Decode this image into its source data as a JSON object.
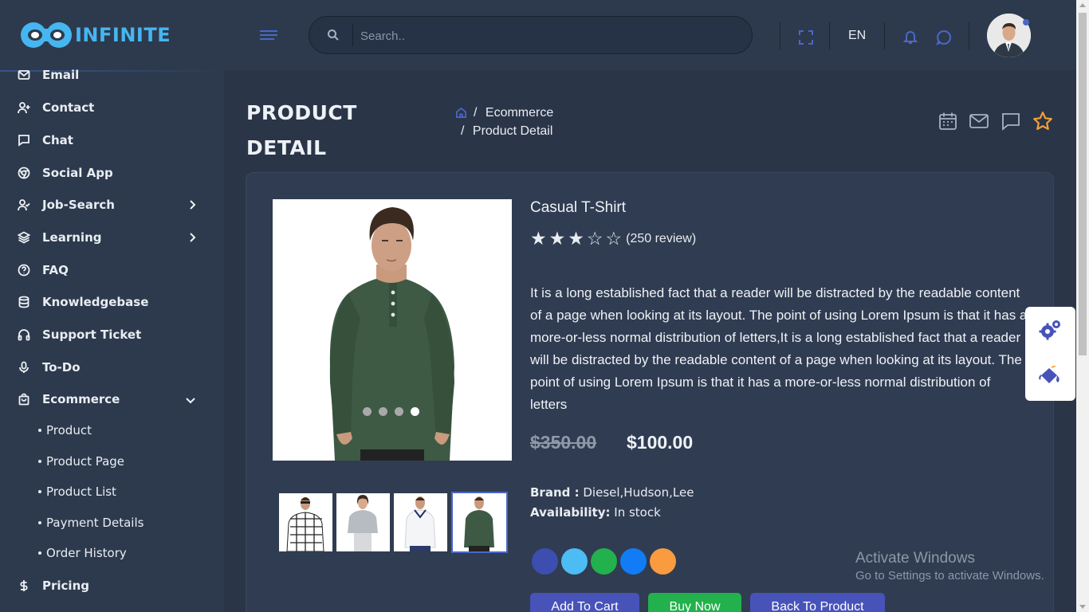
{
  "brand": {
    "name": "INFINITE",
    "accent": "#45b6f0"
  },
  "header": {
    "search_placeholder": "Search..",
    "language": "EN",
    "icons": [
      "menu-icon",
      "search-icon",
      "fullscreen-icon",
      "bell-icon",
      "chat-bubble-icon"
    ]
  },
  "sidebar": {
    "items": [
      {
        "label": "Email",
        "icon": "mail-icon"
      },
      {
        "label": "Contact",
        "icon": "user-plus-icon"
      },
      {
        "label": "Chat",
        "icon": "chat-icon"
      },
      {
        "label": "Social App",
        "icon": "chrome-icon"
      },
      {
        "label": "Job-Search",
        "icon": "user-check-icon"
      },
      {
        "label": "Learning",
        "icon": "layers-icon"
      },
      {
        "label": "FAQ",
        "icon": "help-circle-icon"
      },
      {
        "label": "Knowledgebase",
        "icon": "database-icon"
      },
      {
        "label": "Support Ticket",
        "icon": "headphones-icon"
      },
      {
        "label": "To-Do",
        "icon": "mic-icon"
      },
      {
        "label": "Ecommerce",
        "icon": "shopping-bag-icon"
      },
      {
        "label": "Pricing",
        "icon": "dollar-icon"
      }
    ],
    "ecommerce_sub": [
      "Product",
      "Product Page",
      "Product List",
      "Payment Details",
      "Order History"
    ]
  },
  "page": {
    "title_line1": "PRODUCT",
    "title_line2": "DETAIL",
    "breadcrumb": [
      "Ecommerce",
      "Product Detail"
    ],
    "breadcrumb_sep": "/"
  },
  "product": {
    "name": "Casual T-Shirt",
    "rating": 3,
    "rating_max": 5,
    "reviews": "(250 review)",
    "description": "It is a long established fact that a reader will be distracted by the readable content of a page when looking at its layout. The point of using Lorem Ipsum is that it has a more-or-less normal distribution of letters,It is a long established fact that a reader will be distracted by the readable content of a page when looking at its layout. The point of using Lorem Ipsum is that it has a more-or-less normal distribution of letters",
    "old_price": "$350.00 ",
    "price": "$100.00",
    "brand_label": "Brand :",
    "brand_value": "Diesel,Hudson,Lee",
    "availability_label": "Availability:",
    "availability_value": "In stock",
    "colors": [
      "#3d4eb0",
      "#4dbcf4",
      "#22b14c",
      "#117cf5",
      "#f99b3f"
    ],
    "active_slide": 4,
    "slide_count": 4
  },
  "buttons": {
    "add_to_cart": "Add To Cart",
    "buy_now": "Buy Now",
    "back": "Back To Product"
  },
  "windows_notice": {
    "line1": "Activate Windows",
    "line2": "Go to Settings to activate Windows."
  }
}
